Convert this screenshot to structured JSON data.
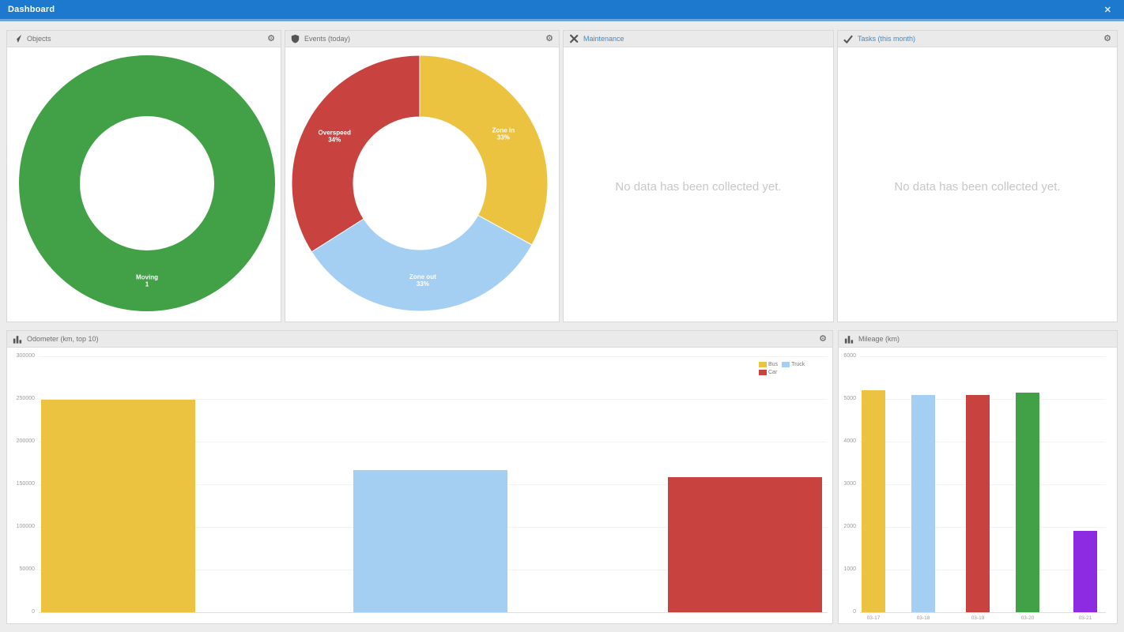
{
  "titlebar": {
    "title": "Dashboard",
    "close_glyph": "✕"
  },
  "icons": {
    "gear_glyph": "⚙",
    "objects_icon": "navigation-arrow",
    "events_icon": "shield",
    "maintenance_icon": "crossed-tools",
    "tasks_icon": "checkmark",
    "odometer_icon": "bar-chart",
    "mileage_icon": "bar-chart"
  },
  "panels": {
    "objects": {
      "title": "Objects"
    },
    "events": {
      "title": "Events (today)"
    },
    "maintenance": {
      "title": "Maintenance",
      "empty_text": "No data has been collected yet."
    },
    "tasks": {
      "title": "Tasks (this month)",
      "empty_text": "No data has been collected yet."
    },
    "odometer": {
      "title": "Odometer (km, top 10)"
    },
    "mileage": {
      "title": "Mileage (km)"
    }
  },
  "colors": {
    "titlebar_blue": "#1d79cd",
    "green": "#42a047",
    "yellow": "#ecc340",
    "light_blue": "#a4cef2",
    "red": "#c8433f",
    "purple": "#8c2be2",
    "header_link_blue": "#4287c6"
  },
  "chart_data": [
    {
      "id": "objects_donut",
      "type": "pie",
      "donut": true,
      "title": "Objects",
      "slices": [
        {
          "label": "Moving",
          "sub": "1",
          "value": 1,
          "pct": 100,
          "color": "#42a047"
        }
      ]
    },
    {
      "id": "events_donut",
      "type": "pie",
      "donut": true,
      "title": "Events (today)",
      "slices": [
        {
          "label": "Zone in",
          "sub": "33%",
          "pct": 33,
          "color": "#ecc340"
        },
        {
          "label": "Zone out",
          "sub": "33%",
          "pct": 33,
          "color": "#a4cef2"
        },
        {
          "label": "Overspeed",
          "sub": "34%",
          "pct": 34,
          "color": "#c8433f"
        }
      ]
    },
    {
      "id": "odometer_bars",
      "type": "bar",
      "title": "Odometer (km, top 10)",
      "categories": [
        "Bus",
        "Truck",
        "Car"
      ],
      "values": [
        249000,
        167000,
        158000
      ],
      "colors": [
        "#ecc340",
        "#a4cef2",
        "#c8433f"
      ],
      "ylim": [
        0,
        300000
      ],
      "yticks": [
        0,
        50000,
        100000,
        150000,
        200000,
        250000,
        300000
      ],
      "grid": true,
      "x_labels_shown": false,
      "legend_position": "top-right"
    },
    {
      "id": "mileage_bars",
      "type": "bar",
      "title": "Mileage (km)",
      "categories": [
        "03-17",
        "03-18",
        "03-19",
        "03-20",
        "03-21"
      ],
      "values": [
        5200,
        5100,
        5100,
        5150,
        1900
      ],
      "colors": [
        "#ecc340",
        "#a4cef2",
        "#c8433f",
        "#42a047",
        "#8c2be2"
      ],
      "ylim": [
        0,
        6000
      ],
      "yticks": [
        0,
        1000,
        2000,
        3000,
        4000,
        5000,
        6000
      ],
      "grid": true,
      "x_labels_shown": true
    }
  ]
}
